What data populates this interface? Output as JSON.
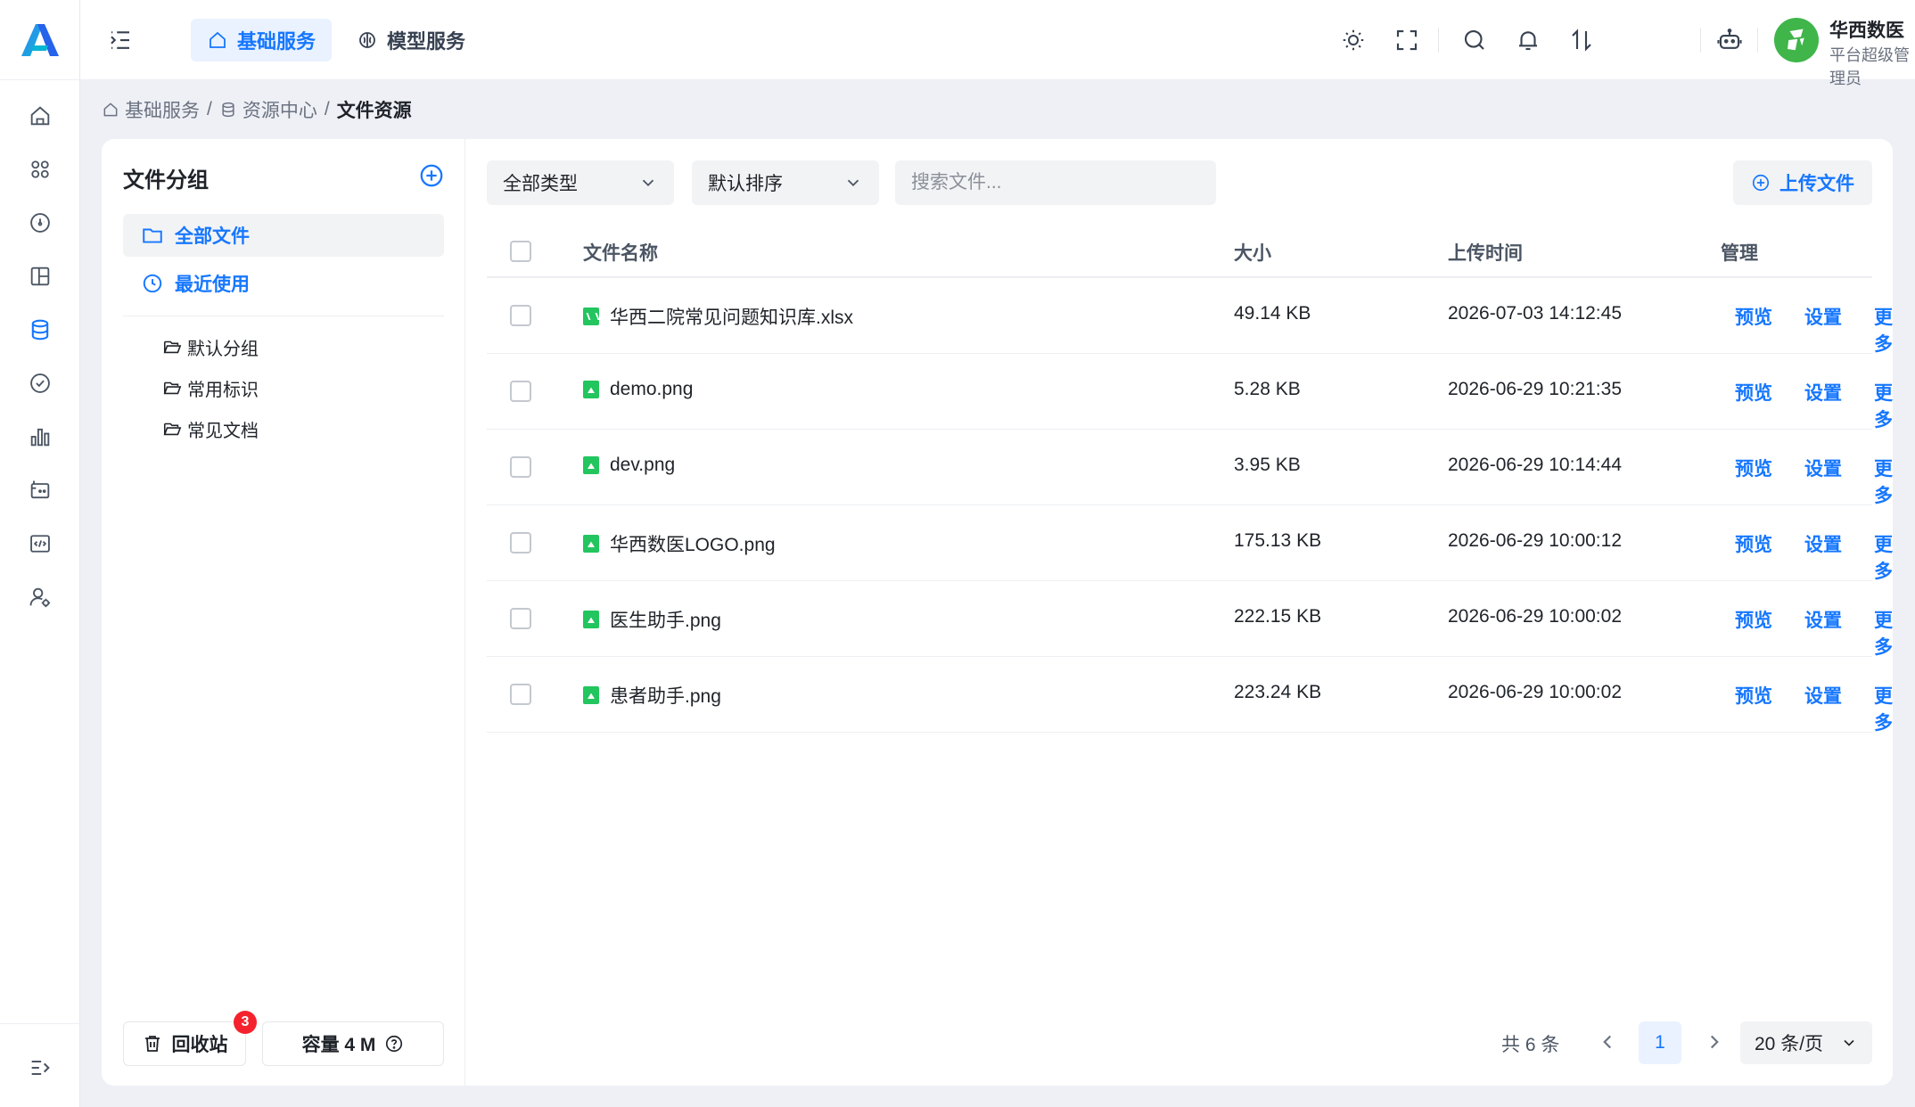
{
  "header": {
    "tabs": [
      {
        "label": "基础服务",
        "icon": "home-icon",
        "active": true
      },
      {
        "label": "模型服务",
        "icon": "brain-icon",
        "active": false
      }
    ],
    "icons": [
      "theme-sun-icon",
      "fullscreen-icon",
      "search-icon",
      "notification-bell-icon",
      "sort-arrows-icon",
      "robot-icon"
    ],
    "user": {
      "name": "华西数医",
      "role": "平台超级管理员",
      "avatar_color": "#3fb54a"
    }
  },
  "sidebar": {
    "icons": [
      "home-icon",
      "apps-icon",
      "dashboard-icon",
      "layout-icon",
      "database-icon",
      "check-circle-icon",
      "bar-chart-icon",
      "media-icon",
      "code-icon",
      "user-settings-icon"
    ],
    "active": "database-icon"
  },
  "breadcrumb": {
    "items": [
      "基础服务",
      "资源中心"
    ],
    "current": "文件资源",
    "sep": "/"
  },
  "groups": {
    "title": "文件分组",
    "nav": [
      "全部文件",
      "最近使用"
    ],
    "folders": [
      "默认分组",
      "常用标识",
      "常见文档"
    ],
    "recycle_label": "回收站",
    "recycle_count": "3",
    "capacity_label": "容量 4 M"
  },
  "toolbar": {
    "type_select": "全部类型",
    "sort_select": "默认排序",
    "search_placeholder": "搜索文件...",
    "upload_label": "上传文件"
  },
  "table": {
    "headers": [
      "文件名称",
      "大小",
      "上传时间",
      "管理"
    ],
    "rows": [
      {
        "name": "华西二院常见问题知识库.xlsx",
        "size": "49.14 KB",
        "time": "2026-07-03 14:12:45",
        "type": "xlsx"
      },
      {
        "name": "demo.png",
        "size": "5.28 KB",
        "time": "2026-06-29 10:21:35",
        "type": "png"
      },
      {
        "name": "dev.png",
        "size": "3.95 KB",
        "time": "2026-06-29 10:14:44",
        "type": "png"
      },
      {
        "name": "华西数医LOGO.png",
        "size": "175.13 KB",
        "time": "2026-06-29 10:00:12",
        "type": "png"
      },
      {
        "name": "医生助手.png",
        "size": "222.15 KB",
        "time": "2026-06-29 10:00:02",
        "type": "png"
      },
      {
        "name": "患者助手.png",
        "size": "223.24 KB",
        "time": "2026-06-29 10:00:02",
        "type": "png"
      }
    ],
    "actions": [
      "预览",
      "设置",
      "更多"
    ]
  },
  "pagination": {
    "total": "共 6 条",
    "current_page": "1",
    "page_size": "20 条/页"
  },
  "colors": {
    "accent": "#1677ff",
    "file_icon": "#22c55e",
    "badge": "#f5222d"
  }
}
